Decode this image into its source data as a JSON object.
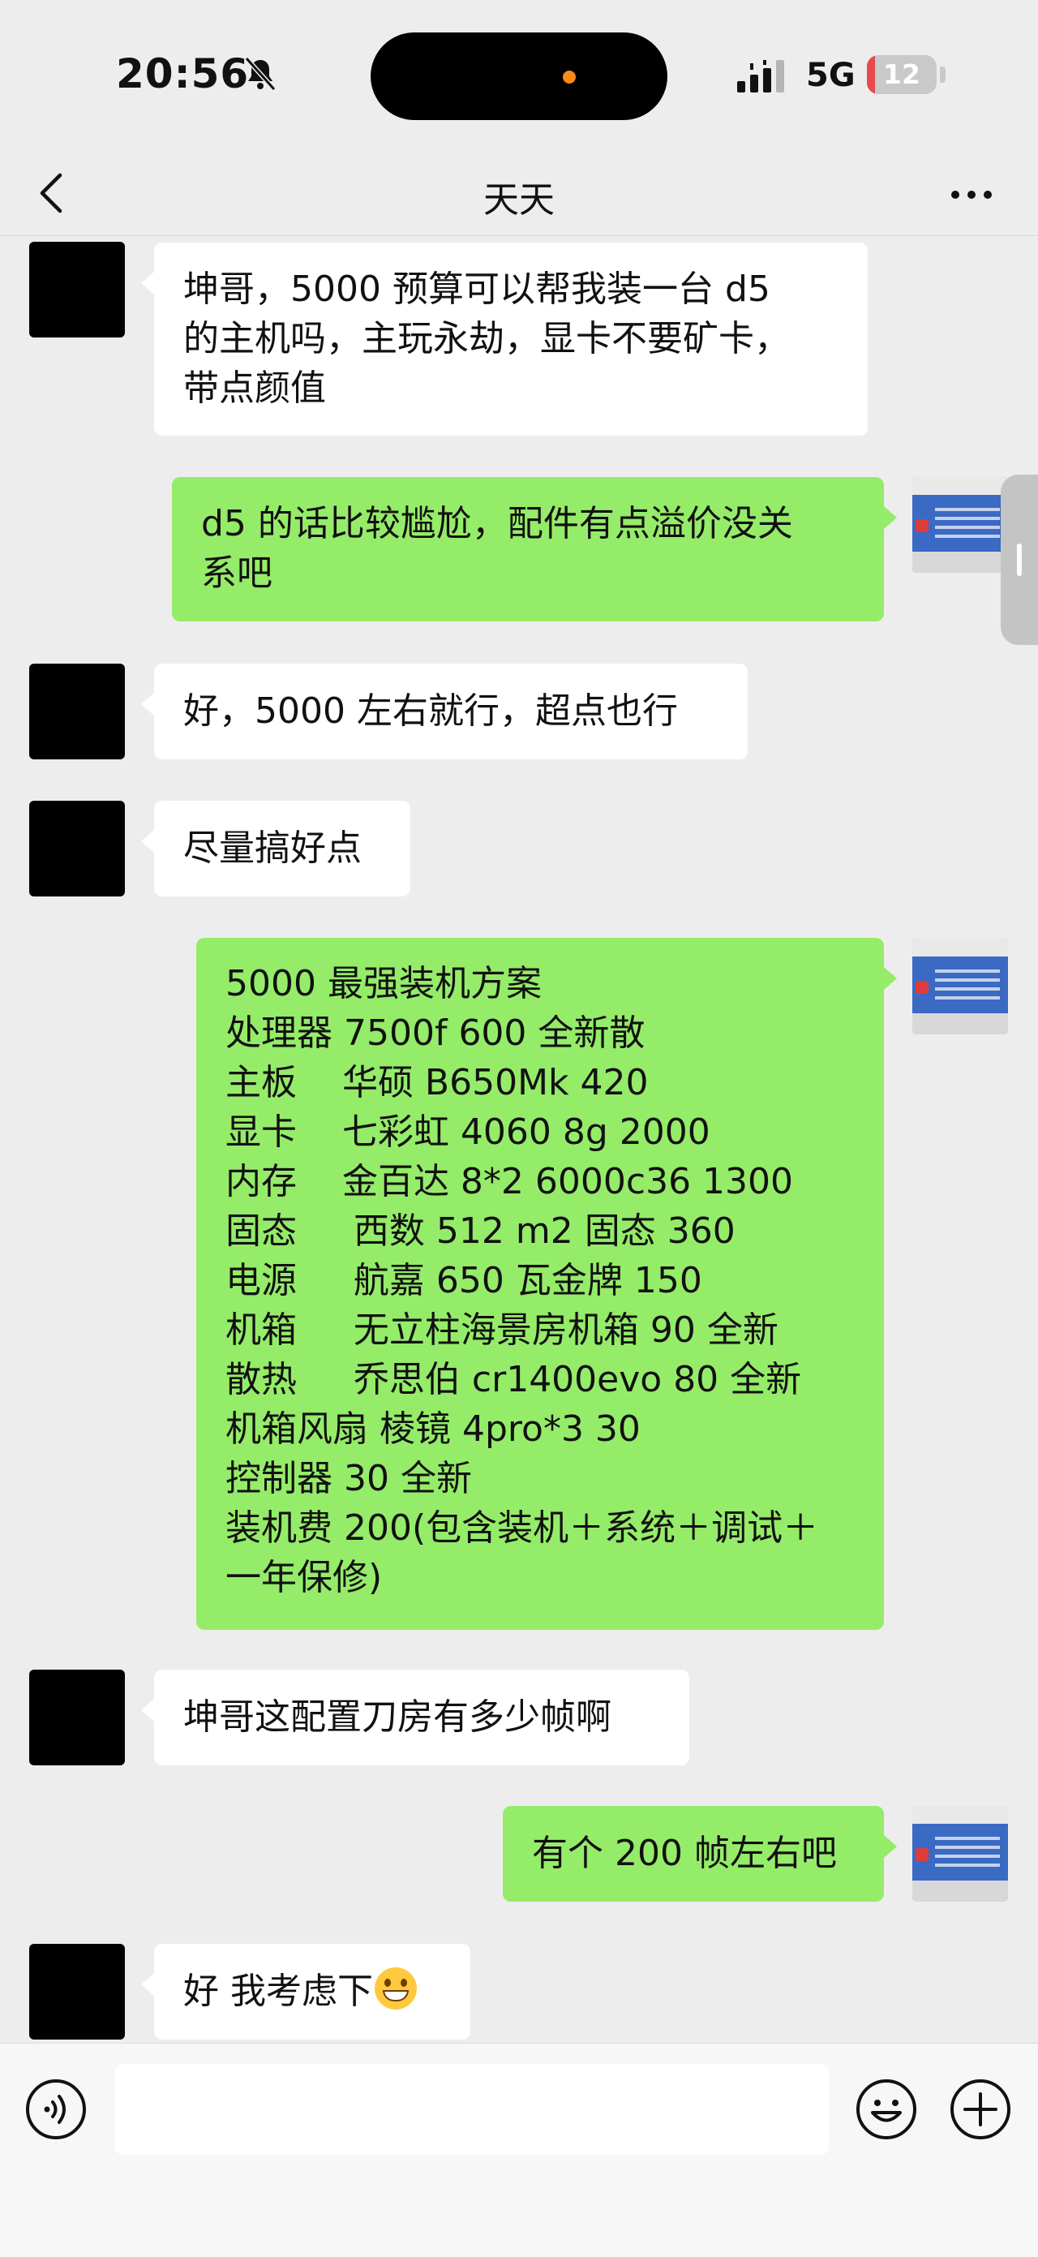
{
  "status": {
    "time": "20:56",
    "network": "5G",
    "battery": "12",
    "battery_level": 0.12
  },
  "nav": {
    "title": "天天"
  },
  "messages": [
    {
      "side": "left",
      "text": "坤哥，5000 预算可以帮我装一台 d5\n的主机吗，主玩永劫，显卡不要矿卡，\n带点颜值"
    },
    {
      "side": "right",
      "text": "d5 的话比较尴尬，配件有点溢价没关\n系吧"
    },
    {
      "side": "left",
      "text": "好，5000 左右就行，超点也行"
    },
    {
      "side": "left",
      "text": "尽量搞好点"
    },
    {
      "side": "right",
      "text": "5000 最强装机方案\n处理器 7500f 600 全新散\n主板    华硕 B650Mk 420\n显卡    七彩虹 4060 8g 2000\n内存    金百达 8*2 6000c36 1300\n固态     西数 512 m2 固态 360\n电源     航嘉 650 瓦金牌 150\n机箱     无立柱海景房机箱 90 全新\n散热     乔思伯 cr1400evo 80 全新\n机箱风扇 棱镜 4pro*3 30\n控制器 30 全新\n装机费 200(包含装机＋系统＋调试＋\n一年保修)"
    },
    {
      "side": "left",
      "text": "坤哥这配置刀房有多少帧啊"
    },
    {
      "side": "right",
      "text": "有个 200 帧左右吧"
    },
    {
      "side": "left",
      "text": "好 我考虑下",
      "emoji": "grinning-face-emoji"
    }
  ],
  "input": {
    "value": "",
    "placeholder": ""
  },
  "colors": {
    "background": "#ededed",
    "bubble_self": "#95ec69",
    "bubble_other": "#ffffff",
    "battery_low": "#e84a4a"
  },
  "icons": [
    "bell-slash-icon",
    "signal-icon",
    "back-chevron-icon",
    "more-dots-icon",
    "voice-icon",
    "emoji-icon",
    "plus-icon"
  ]
}
